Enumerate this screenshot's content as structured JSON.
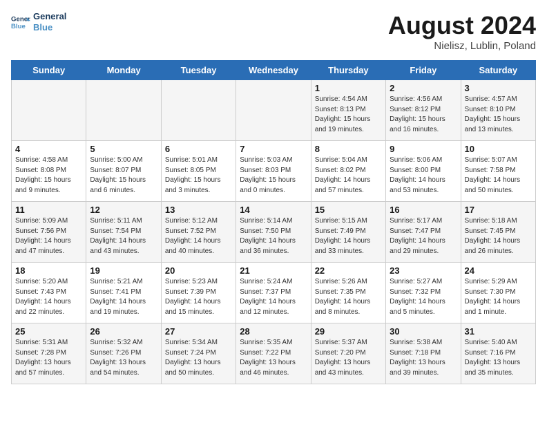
{
  "header": {
    "logo_line1": "General",
    "logo_line2": "Blue",
    "title": "August 2024",
    "subtitle": "Nielisz, Lublin, Poland"
  },
  "weekdays": [
    "Sunday",
    "Monday",
    "Tuesday",
    "Wednesday",
    "Thursday",
    "Friday",
    "Saturday"
  ],
  "weeks": [
    [
      {
        "day": "",
        "info": ""
      },
      {
        "day": "",
        "info": ""
      },
      {
        "day": "",
        "info": ""
      },
      {
        "day": "",
        "info": ""
      },
      {
        "day": "1",
        "info": "Sunrise: 4:54 AM\nSunset: 8:13 PM\nDaylight: 15 hours\nand 19 minutes."
      },
      {
        "day": "2",
        "info": "Sunrise: 4:56 AM\nSunset: 8:12 PM\nDaylight: 15 hours\nand 16 minutes."
      },
      {
        "day": "3",
        "info": "Sunrise: 4:57 AM\nSunset: 8:10 PM\nDaylight: 15 hours\nand 13 minutes."
      }
    ],
    [
      {
        "day": "4",
        "info": "Sunrise: 4:58 AM\nSunset: 8:08 PM\nDaylight: 15 hours\nand 9 minutes."
      },
      {
        "day": "5",
        "info": "Sunrise: 5:00 AM\nSunset: 8:07 PM\nDaylight: 15 hours\nand 6 minutes."
      },
      {
        "day": "6",
        "info": "Sunrise: 5:01 AM\nSunset: 8:05 PM\nDaylight: 15 hours\nand 3 minutes."
      },
      {
        "day": "7",
        "info": "Sunrise: 5:03 AM\nSunset: 8:03 PM\nDaylight: 15 hours\nand 0 minutes."
      },
      {
        "day": "8",
        "info": "Sunrise: 5:04 AM\nSunset: 8:02 PM\nDaylight: 14 hours\nand 57 minutes."
      },
      {
        "day": "9",
        "info": "Sunrise: 5:06 AM\nSunset: 8:00 PM\nDaylight: 14 hours\nand 53 minutes."
      },
      {
        "day": "10",
        "info": "Sunrise: 5:07 AM\nSunset: 7:58 PM\nDaylight: 14 hours\nand 50 minutes."
      }
    ],
    [
      {
        "day": "11",
        "info": "Sunrise: 5:09 AM\nSunset: 7:56 PM\nDaylight: 14 hours\nand 47 minutes."
      },
      {
        "day": "12",
        "info": "Sunrise: 5:11 AM\nSunset: 7:54 PM\nDaylight: 14 hours\nand 43 minutes."
      },
      {
        "day": "13",
        "info": "Sunrise: 5:12 AM\nSunset: 7:52 PM\nDaylight: 14 hours\nand 40 minutes."
      },
      {
        "day": "14",
        "info": "Sunrise: 5:14 AM\nSunset: 7:50 PM\nDaylight: 14 hours\nand 36 minutes."
      },
      {
        "day": "15",
        "info": "Sunrise: 5:15 AM\nSunset: 7:49 PM\nDaylight: 14 hours\nand 33 minutes."
      },
      {
        "day": "16",
        "info": "Sunrise: 5:17 AM\nSunset: 7:47 PM\nDaylight: 14 hours\nand 29 minutes."
      },
      {
        "day": "17",
        "info": "Sunrise: 5:18 AM\nSunset: 7:45 PM\nDaylight: 14 hours\nand 26 minutes."
      }
    ],
    [
      {
        "day": "18",
        "info": "Sunrise: 5:20 AM\nSunset: 7:43 PM\nDaylight: 14 hours\nand 22 minutes."
      },
      {
        "day": "19",
        "info": "Sunrise: 5:21 AM\nSunset: 7:41 PM\nDaylight: 14 hours\nand 19 minutes."
      },
      {
        "day": "20",
        "info": "Sunrise: 5:23 AM\nSunset: 7:39 PM\nDaylight: 14 hours\nand 15 minutes."
      },
      {
        "day": "21",
        "info": "Sunrise: 5:24 AM\nSunset: 7:37 PM\nDaylight: 14 hours\nand 12 minutes."
      },
      {
        "day": "22",
        "info": "Sunrise: 5:26 AM\nSunset: 7:35 PM\nDaylight: 14 hours\nand 8 minutes."
      },
      {
        "day": "23",
        "info": "Sunrise: 5:27 AM\nSunset: 7:32 PM\nDaylight: 14 hours\nand 5 minutes."
      },
      {
        "day": "24",
        "info": "Sunrise: 5:29 AM\nSunset: 7:30 PM\nDaylight: 14 hours\nand 1 minute."
      }
    ],
    [
      {
        "day": "25",
        "info": "Sunrise: 5:31 AM\nSunset: 7:28 PM\nDaylight: 13 hours\nand 57 minutes."
      },
      {
        "day": "26",
        "info": "Sunrise: 5:32 AM\nSunset: 7:26 PM\nDaylight: 13 hours\nand 54 minutes."
      },
      {
        "day": "27",
        "info": "Sunrise: 5:34 AM\nSunset: 7:24 PM\nDaylight: 13 hours\nand 50 minutes."
      },
      {
        "day": "28",
        "info": "Sunrise: 5:35 AM\nSunset: 7:22 PM\nDaylight: 13 hours\nand 46 minutes."
      },
      {
        "day": "29",
        "info": "Sunrise: 5:37 AM\nSunset: 7:20 PM\nDaylight: 13 hours\nand 43 minutes."
      },
      {
        "day": "30",
        "info": "Sunrise: 5:38 AM\nSunset: 7:18 PM\nDaylight: 13 hours\nand 39 minutes."
      },
      {
        "day": "31",
        "info": "Sunrise: 5:40 AM\nSunset: 7:16 PM\nDaylight: 13 hours\nand 35 minutes."
      }
    ]
  ]
}
